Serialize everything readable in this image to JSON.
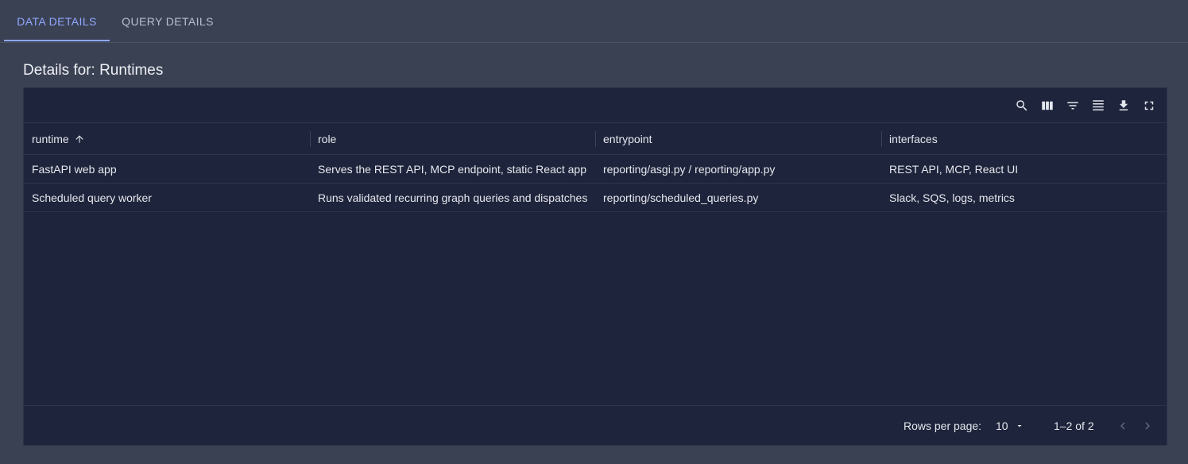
{
  "tabs": [
    {
      "label": "DATA DETAILS",
      "active": true
    },
    {
      "label": "QUERY DETAILS",
      "active": false
    }
  ],
  "title": "Details for: Runtimes",
  "toolbar": {
    "icons": [
      "search-icon",
      "columns-icon",
      "filter-icon",
      "density-icon",
      "download-icon",
      "fullscreen-icon"
    ]
  },
  "table": {
    "columns": [
      "runtime",
      "role",
      "entrypoint",
      "interfaces"
    ],
    "sort": {
      "column": "runtime",
      "direction": "asc"
    },
    "rows": [
      [
        "FastAPI web app",
        "Serves the REST API, MCP endpoint, static React app",
        "reporting/asgi.py / reporting/app.py",
        "REST API, MCP, React UI"
      ],
      [
        "Scheduled query worker",
        "Runs validated recurring graph queries and dispatches",
        "reporting/scheduled_queries.py",
        "Slack, SQS, logs, metrics"
      ]
    ]
  },
  "pagination": {
    "rows_per_page_label": "Rows per page:",
    "rows_per_page": "10",
    "range": "1–2 of 2"
  },
  "colors": {
    "background": "#3a4153",
    "panel": "#1e243b",
    "accent": "#90a7ff"
  }
}
